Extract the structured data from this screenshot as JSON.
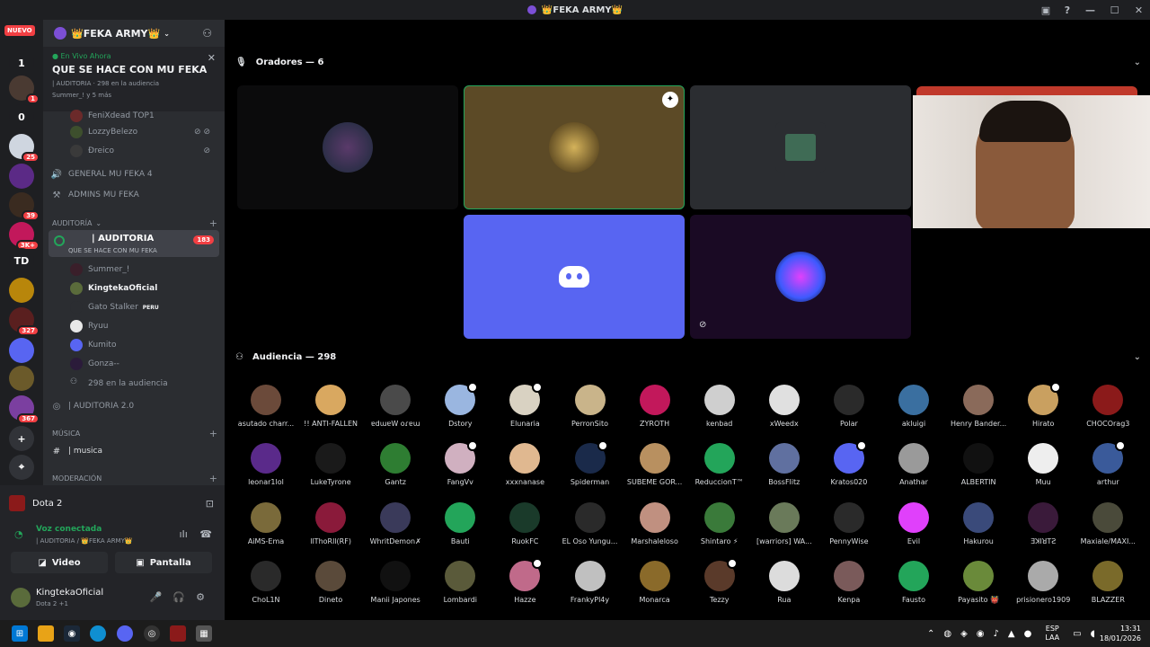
{
  "window": {
    "title": "👑FEKA ARMY👑"
  },
  "servers": {
    "nuevo": "NUEVO",
    "items": [
      {
        "label": "1",
        "bg": "#1e1f22",
        "badge": ""
      },
      {
        "label": "",
        "bg": "#4a3a32",
        "badge": "1"
      },
      {
        "label": "0",
        "bg": "#1e1f22",
        "badge": ""
      },
      {
        "label": "",
        "bg": "#cfd6e0",
        "badge": "25"
      },
      {
        "label": "",
        "bg": "#5b2a86",
        "badge": ""
      },
      {
        "label": "",
        "bg": "#3a2b20",
        "badge": "39"
      },
      {
        "label": "",
        "bg": "#c2185b",
        "badge": "3K+"
      },
      {
        "label": "TD",
        "bg": "#1e1f22",
        "badge": ""
      },
      {
        "label": "",
        "bg": "#b8860b",
        "badge": ""
      },
      {
        "label": "",
        "bg": "#5a1f1f",
        "badge": "327"
      },
      {
        "label": "",
        "bg": "#5865f2",
        "badge": ""
      },
      {
        "label": "",
        "bg": "#6b5a2a",
        "badge": ""
      },
      {
        "label": "",
        "bg": "#7b3fa0",
        "badge": "367"
      },
      {
        "label": "+",
        "bg": "#313338",
        "badge": ""
      },
      {
        "label": "⌖",
        "bg": "#313338",
        "badge": ""
      }
    ]
  },
  "guild": {
    "name": "👑FEKA ARMY👑",
    "live": {
      "status": "En Vivo Ahora",
      "title": "QUE SE HACE CON MU FEKA",
      "meta": "| AUDITORIA · 298 en la audiencia",
      "users": "Summer_! y 5 más"
    },
    "top_users": [
      "FeniXdead TOP1",
      "LozzyBelezo",
      "Ðreico"
    ],
    "channels_top": [
      {
        "icon": "🔊",
        "label": "GENERAL MU FEKA 4"
      },
      {
        "icon": "⚒",
        "label": "ADMINS MU FEKA"
      }
    ],
    "cat_auditoria": "AUDITORÍA",
    "auditoria": {
      "name": "| AUDITORIA",
      "topic": "QUE SE HACE CON MU FEKA",
      "count": "183"
    },
    "speakers_list": [
      {
        "name": "Summer_!",
        "bold": false,
        "tag": "",
        "color": "#3a1f2a"
      },
      {
        "name": "KingtekaOficial",
        "bold": true,
        "tag": "",
        "color": "#5a6b3b"
      },
      {
        "name": "Gato Stalker",
        "bold": false,
        "tag": "PERU",
        "color": "#2b2d31"
      },
      {
        "name": "Ryuu",
        "bold": false,
        "tag": "",
        "color": "#e8e8e8"
      },
      {
        "name": "Kumito",
        "bold": false,
        "tag": "",
        "color": "#5865f2"
      },
      {
        "name": "Gonza--",
        "bold": false,
        "tag": "",
        "color": "#2b1b3a"
      }
    ],
    "audience_row": "298 en la audiencia",
    "auditoria2": "| AUDITORIA 2.0",
    "cat_musica": "MÚSICA",
    "musica_channel": "| musica",
    "cat_moderacion": "MODERACIÓN"
  },
  "panel": {
    "game": "Dota 2",
    "voice_status": "Voz conectada",
    "voice_channel": "| AUDITORIA / 👑FEKA ARMY👑",
    "video_label": "Video",
    "screen_label": "Pantalla",
    "user_name": "KingtekaOficial",
    "user_status": "Dota 2 +1"
  },
  "stage": {
    "speakers_header": "Oradores — 6",
    "audience_header": "Audiencia — 298",
    "audience": [
      "asutado charr...",
      "!! ANTI-FALLEN",
      "ɐdɯɐW oɾɐɯ",
      "Dstory",
      "Elunaria",
      "PerronSito",
      "ZYROTH",
      "kenbad",
      "xWeedx",
      "Polar",
      "akluigi",
      "Henry Bander...",
      "Hirato",
      "CHOCOrag3",
      "leonar1lol",
      "LukeTyrone",
      "Gantz",
      "FangVv",
      "xxxnanase",
      "Spiderman",
      "SUBEME GOR...",
      "ReduccionT™",
      "BossFlitz",
      "Kratos020",
      "Anathar",
      "ALBERTIN",
      "Muu",
      "arthur",
      "AiMS-Ema",
      "llThoRll(RF)",
      "WhritDemon✗",
      "Bauti",
      "RuokFC",
      "EL Oso Yungu...",
      "Marshaleloso",
      "Shintaro ⚡",
      "[warriors] WA...",
      "PennyWise",
      "Evil",
      "Hakurou",
      "ƎꓘIꓤTƧ",
      "Maxiale/MAXI...",
      "ChoL1N",
      "Dineto",
      "Manii Japones",
      "Lombardi",
      "Hazze",
      "FrankyPl4y",
      "Monarca",
      "Tezzy",
      "Rua",
      "Kenpa",
      "Fausto",
      "Payasito 👹",
      "prisionero1909",
      "BLAZZER"
    ]
  },
  "taskbar": {
    "lang1": "ESP",
    "lang2": "LAA",
    "time": "13:31",
    "date": "18/01/2026"
  },
  "colors": {
    "accent": "#5865f2",
    "online": "#23a55a",
    "danger": "#f23f43"
  }
}
